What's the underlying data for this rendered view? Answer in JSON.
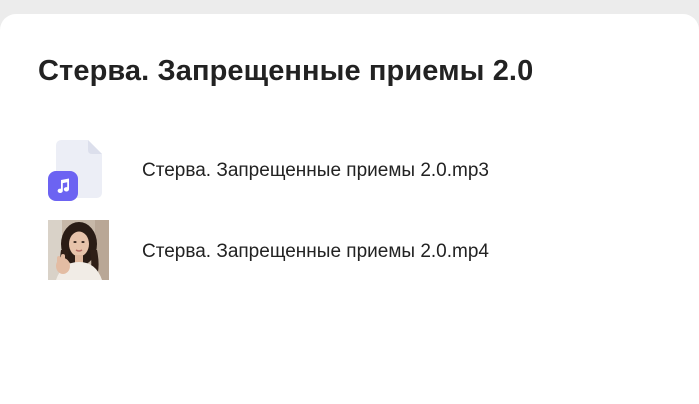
{
  "page": {
    "title": "Стерва. Запрещенные приемы 2.0"
  },
  "files": [
    {
      "name": "Стерва. Запрещенные приемы 2.0.mp3",
      "type": "audio",
      "icon": "music-note-icon",
      "badge_color": "#6c63f2"
    },
    {
      "name": "Стерва. Запрещенные приемы 2.0.mp4",
      "type": "video",
      "icon": "video-thumbnail"
    }
  ]
}
